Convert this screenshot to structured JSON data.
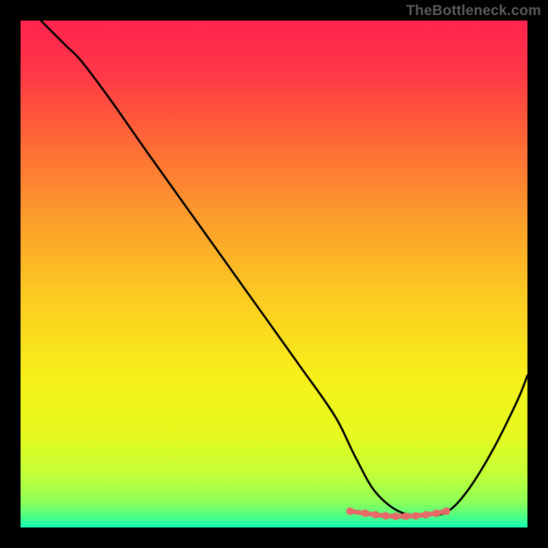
{
  "watermark": "TheBottleneck.com",
  "chart_data": {
    "type": "line",
    "title": "",
    "xlabel": "",
    "ylabel": "",
    "xlim": [
      0,
      100
    ],
    "ylim": [
      0,
      100
    ],
    "grid": false,
    "legend": false,
    "background_gradient": {
      "stops": [
        {
          "pos": 0.0,
          "color": "#ff244f"
        },
        {
          "pos": 0.1,
          "color": "#ff3647"
        },
        {
          "pos": 0.25,
          "color": "#fe6d36"
        },
        {
          "pos": 0.4,
          "color": "#fca02b"
        },
        {
          "pos": 0.55,
          "color": "#fbcc20"
        },
        {
          "pos": 0.7,
          "color": "#f7ef1a"
        },
        {
          "pos": 0.82,
          "color": "#e6fa1f"
        },
        {
          "pos": 0.9,
          "color": "#bfff3a"
        },
        {
          "pos": 0.95,
          "color": "#8dff58"
        },
        {
          "pos": 0.975,
          "color": "#54ff7e"
        },
        {
          "pos": 1.0,
          "color": "#12ffb5"
        }
      ]
    },
    "series": [
      {
        "name": "bottleneck-curve",
        "color": "#000000",
        "x": [
          4,
          6,
          9,
          12,
          18,
          25,
          35,
          45,
          55,
          62,
          66,
          70,
          75,
          80,
          84,
          88,
          93,
          98,
          100
        ],
        "values": [
          100,
          98,
          95,
          92,
          84,
          74,
          60,
          46,
          32,
          22,
          14,
          7,
          3,
          2.5,
          3,
          7,
          15,
          25,
          30
        ]
      },
      {
        "name": "bottom-markers",
        "type": "scatter",
        "color": "#e76a6a",
        "x": [
          65,
          68,
          70,
          72,
          74,
          76,
          78,
          80,
          82,
          84
        ],
        "values": [
          3.2,
          2.8,
          2.5,
          2.3,
          2.2,
          2.2,
          2.3,
          2.5,
          2.8,
          3.2
        ]
      }
    ],
    "annotations": []
  }
}
